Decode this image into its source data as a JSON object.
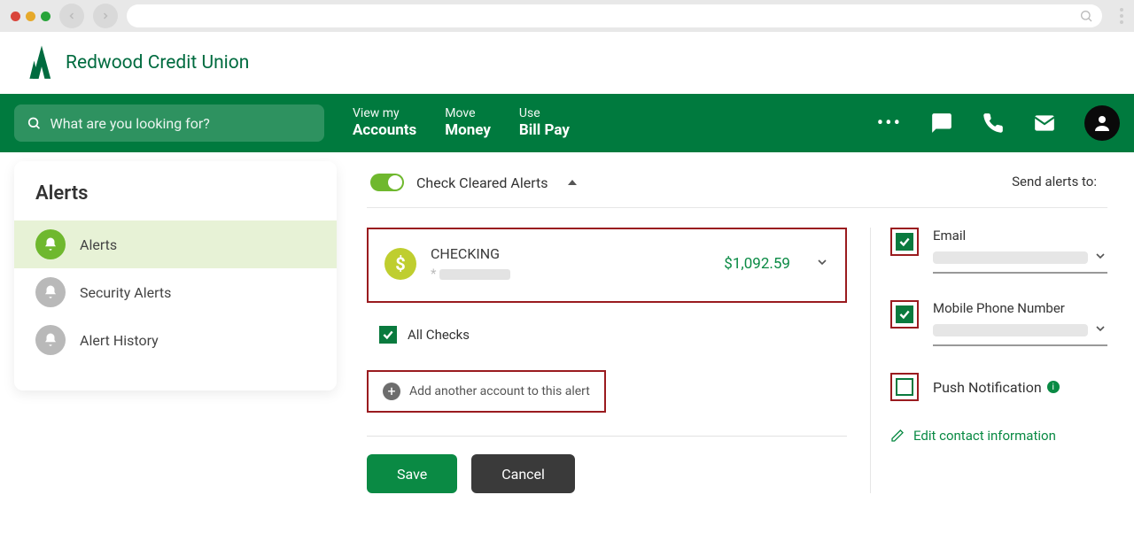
{
  "brand": {
    "name": "Redwood Credit Union"
  },
  "search": {
    "placeholder": "What are you looking for?"
  },
  "nav": {
    "accounts_top": "View my",
    "accounts_bot": "Accounts",
    "money_top": "Move",
    "money_bot": "Money",
    "billpay_top": "Use",
    "billpay_bot": "Bill Pay"
  },
  "sidebar": {
    "title": "Alerts",
    "items": [
      {
        "label": "Alerts"
      },
      {
        "label": "Security Alerts"
      },
      {
        "label": "Alert History"
      }
    ]
  },
  "toggle": {
    "label": "Check Cleared Alerts"
  },
  "sendto_label": "Send alerts to:",
  "account": {
    "name": "CHECKING",
    "mask_prefix": "*",
    "balance": "$1,092.59"
  },
  "all_checks_label": "All Checks",
  "add_account_label": "Add another account to this alert",
  "buttons": {
    "save": "Save",
    "cancel": "Cancel"
  },
  "channels": {
    "email_label": "Email",
    "mobile_label": "Mobile Phone Number",
    "push_label": "Push Notification"
  },
  "edit_contact_label": "Edit contact information"
}
